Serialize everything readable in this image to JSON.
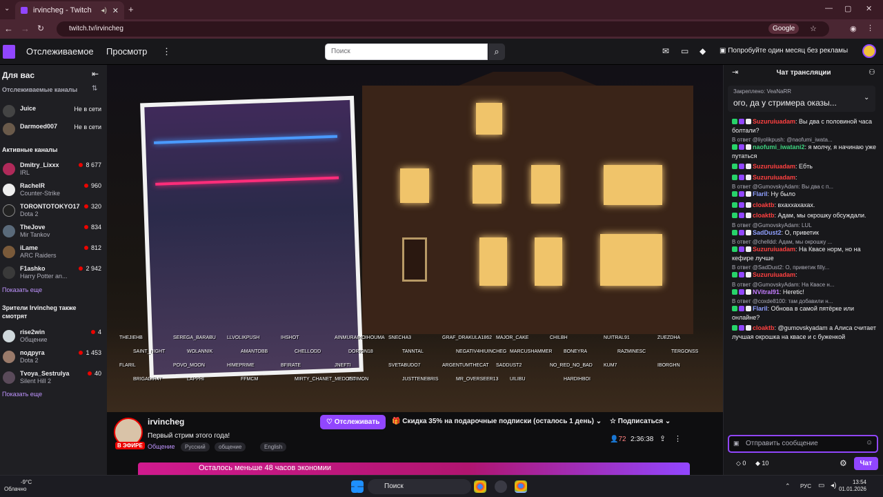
{
  "browser": {
    "tab_title": "irvincheg - Twitch",
    "url": "twitch.tv/irvincheg",
    "google_pill": "Google"
  },
  "topnav": {
    "following": "Отслеживаемое",
    "browse": "Просмотр",
    "search_placeholder": "Поиск",
    "promo": "Попробуйте один месяц без рекламы"
  },
  "sidebar": {
    "for_you": "Для вас",
    "followed_title": "Отслеживаемые каналы",
    "followed": [
      {
        "name": "Juice",
        "status": "Не в сети"
      },
      {
        "name": "Darmoed007",
        "status": "Не в сети"
      }
    ],
    "active_title": "Активные каналы",
    "active": [
      {
        "name": "Dmitry_Lixxx",
        "game": "IRL",
        "viewers": "8 677"
      },
      {
        "name": "RachelR",
        "game": "Counter-Strike",
        "viewers": "960"
      },
      {
        "name": "TORONTOTOKYO17",
        "game": "Dota 2",
        "viewers": "320"
      },
      {
        "name": "TheJove",
        "game": "Mir Tankov",
        "viewers": "834"
      },
      {
        "name": "iLame",
        "game": "ARC Raiders",
        "viewers": "812"
      },
      {
        "name": "F1ashko",
        "game": "Harry Potter an...",
        "viewers": "2 942"
      }
    ],
    "show_more": "Показать еще",
    "also_watch_title": "Зрители Irvincheg также смотрят",
    "also_watch": [
      {
        "name": "rise2win",
        "game": "Общение",
        "viewers": "4"
      },
      {
        "name": "подруга",
        "game": "Dota 2",
        "viewers": "1 453"
      },
      {
        "name": "Tvoya_Sestrulya",
        "game": "Silent Hill 2",
        "viewers": "40"
      }
    ],
    "show_more_2": "Показать еще"
  },
  "video": {
    "viewer_names": [
      "THEJIEHB",
      "SEREGA_BARABU",
      "LLVOLIKPUSH",
      "IHSHOT",
      "AINMURAIHOIHOUMA",
      "SNECHA3",
      "GRAF_DRAKULA1862",
      "MAJOR_CAKE",
      "CHILBH",
      "NUITRAL91",
      "ZUEZDHA",
      "SAINT_NIGHT",
      "WOLANNIK",
      "AMANTOBB",
      "CHELLODD",
      "DORION18",
      "TANNTAL",
      "NEGATIV4HIUINCHEG",
      "MARCUSHAMMER",
      "BONEYRA",
      "RAZMINESC",
      "TERGONSS",
      "FLARIL",
      "POVO_MOON",
      "HIMEPRIME",
      "BFIRATE",
      "JNEFTI",
      "SVETABUDO7",
      "ARGENTUMTHECAT",
      "SADDUST2",
      "NO_RED_NO_BAD",
      "KUM7",
      "IBORGHN",
      "BRIGADIR47",
      "LAPPHI",
      "FFMCM",
      "MIRTY_CHANET_MEDOED",
      "ISTIMON",
      "JUSTTENEBRIS",
      "MR_OVERSEER13",
      "UILIBU",
      "HARDIHBOI"
    ]
  },
  "stream": {
    "channel": "irvincheg",
    "live_badge": "В ЭФИРЕ",
    "title": "Первый стрим этого года!",
    "category": "Общение",
    "tags": [
      "Русский",
      "общение",
      "English"
    ],
    "follow": "Отслеживать",
    "gift_offer": "Скидка 35% на подарочные подписки (осталось 1 день)",
    "subscribe": "Подписаться",
    "viewers": "72",
    "uptime": "2:36:38",
    "banner": "Осталось меньше 48 часов экономии"
  },
  "chat": {
    "header": "Чат трансляции",
    "pinned_label": "Закреплено: VeaNaRR",
    "pinned_text": "ого, да у стримера оказы...",
    "messages": [
      {
        "reply": "",
        "user": "Suzuruiuadam",
        "color": "red",
        "text": ": Вы два с половиной часа болтали?"
      },
      {
        "reply": "В ответ @liyolikpush: @naofumi_iwata...",
        "user": "naofumi_iwatani2",
        "color": "green",
        "text": ": я молчу, я начинаю уже путаться"
      },
      {
        "reply": "",
        "user": "Suzuruiuadam",
        "color": "red",
        "text": ": Ебть"
      },
      {
        "reply": "",
        "user": "Suzuruiuadam",
        "color": "red",
        "text": ":"
      },
      {
        "reply": "В ответ @GumovskyAdam: Вы два с п...",
        "user": "Flaril",
        "color": "blue",
        "text": ": Ну было"
      },
      {
        "reply": "",
        "user": "cloaktb",
        "color": "red",
        "text": ": вхаххахахах."
      },
      {
        "reply": "",
        "user": "cloaktb",
        "color": "red",
        "text": ": Адам, мы окрошку обсуждали."
      },
      {
        "reply": "В ответ @GumovskyAdam: LUL",
        "user": "SadDust2",
        "color": "blue",
        "text": ": О, приветик"
      },
      {
        "reply": "В ответ @chelldd: Адам, мы окрошку ...",
        "user": "Suzuruiuadam",
        "color": "red",
        "text": ": На Квасе норм, но на кефире лучше"
      },
      {
        "reply": "В ответ @SadDust2: О, приветик filly...",
        "user": "Suzuruiuadam",
        "color": "red",
        "text": ":"
      },
      {
        "reply": "В ответ @GumovskyAdam: На Квасе н...",
        "user": "NVitral91",
        "color": "purple",
        "text": ": Heretic!"
      },
      {
        "reply": "В ответ @coxde8100: там добавили н...",
        "user": "Flaril",
        "color": "blue",
        "text": ": Обнова в самой пятёрке или онлайне?"
      },
      {
        "reply": "",
        "user": "cloaktb",
        "color": "red",
        "text": ": @gumovskyadam а Алиса считает лучшая окрошка на квасе и с буженкой"
      }
    ],
    "input_placeholder": "Отправить сообщение",
    "points": "0",
    "bits": "10",
    "chat_button": "Чат"
  },
  "taskbar": {
    "weather_temp": "-9°C",
    "weather_desc": "Облачно",
    "search": "Поиск",
    "lang": "РУС",
    "time": "13:54",
    "date": "01.01.2026"
  }
}
